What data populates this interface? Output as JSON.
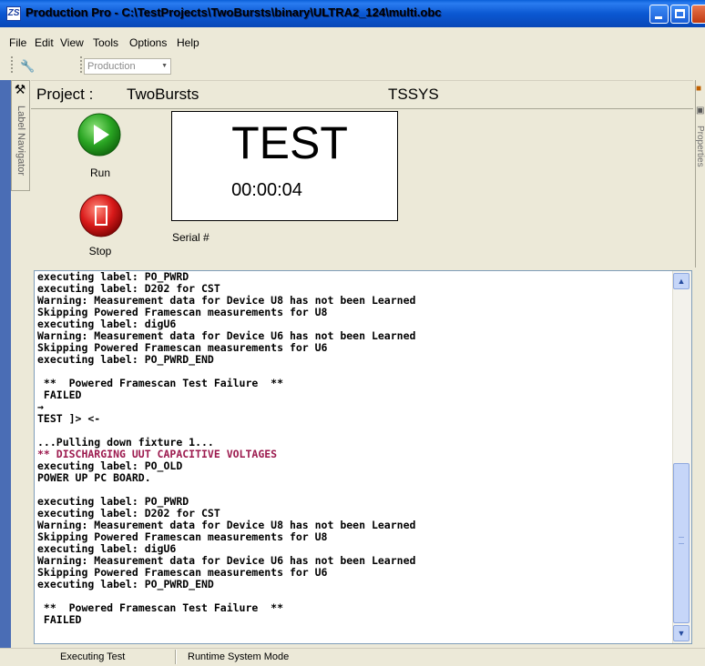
{
  "window": {
    "title": "Production Pro - C:\\TestProjects\\TwoBursts\\binary\\ULTRA2_124\\multi.obc",
    "app_icon": "ZS"
  },
  "menu": {
    "items": [
      {
        "label": "File"
      },
      {
        "label": "Edit"
      },
      {
        "label": "View"
      },
      {
        "label": "Tools"
      },
      {
        "label": "Options"
      },
      {
        "label": "Help"
      }
    ]
  },
  "toolbar": {
    "tool_icon": "wrench-hammer-icon",
    "mode_select": "Production"
  },
  "left_panel": {
    "icon": "tools-icon",
    "label": "Label Navigator"
  },
  "right_panel": {
    "label": "Properties"
  },
  "project": {
    "label": "Project :",
    "name": "TwoBursts",
    "system": "TSSYS"
  },
  "controls": {
    "run_label": "Run",
    "stop_label": "Stop",
    "run_color": "#2aa523",
    "stop_color": "#d91a1a"
  },
  "status": {
    "state": "TEST",
    "elapsed": "00:00:04",
    "serial_label": "Serial #"
  },
  "console": {
    "lines": [
      {
        "text": "executing label: PO_PWRD"
      },
      {
        "text": "executing label: D202 for CST"
      },
      {
        "text": "Warning: Measurement data for Device U8 has not been Learned"
      },
      {
        "text": "Skipping Powered Framescan measurements for U8"
      },
      {
        "text": "executing label: digU6"
      },
      {
        "text": "Warning: Measurement data for Device U6 has not been Learned"
      },
      {
        "text": "Skipping Powered Framescan measurements for U6"
      },
      {
        "text": "executing label: PO_PWRD_END"
      },
      {
        "text": ""
      },
      {
        "text": " **  Powered Framescan Test Failure  **"
      },
      {
        "text": " FAILED"
      },
      {
        "text": "→"
      },
      {
        "text": "TEST ]> <-"
      },
      {
        "text": ""
      },
      {
        "text": "...Pulling down fixture 1..."
      },
      {
        "text": "** DISCHARGING UUT CAPACITIVE VOLTAGES",
        "warn": true
      },
      {
        "text": "executing label: PO_OLD"
      },
      {
        "text": "POWER UP PC BOARD."
      },
      {
        "text": ""
      },
      {
        "text": "executing label: PO_PWRD"
      },
      {
        "text": "executing label: D202 for CST"
      },
      {
        "text": "Warning: Measurement data for Device U8 has not been Learned"
      },
      {
        "text": "Skipping Powered Framescan measurements for U8"
      },
      {
        "text": "executing label: digU6"
      },
      {
        "text": "Warning: Measurement data for Device U6 has not been Learned"
      },
      {
        "text": "Skipping Powered Framescan measurements for U6"
      },
      {
        "text": "executing label: PO_PWRD_END"
      },
      {
        "text": ""
      },
      {
        "text": " **  Powered Framescan Test Failure  **"
      },
      {
        "text": " FAILED"
      }
    ]
  },
  "statusbar": {
    "left": "Executing Test",
    "right": "Runtime System Mode"
  }
}
